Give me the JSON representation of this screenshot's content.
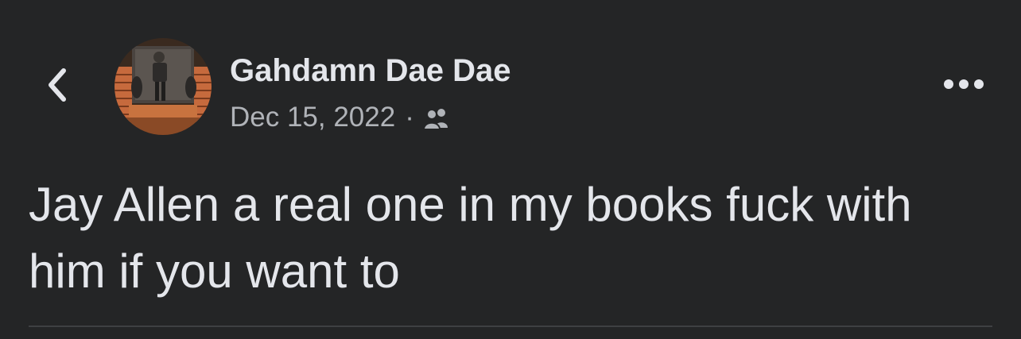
{
  "header": {
    "back_icon": "chevron-left-icon",
    "more_icon": "more-horizontal-icon"
  },
  "post": {
    "author_name": "Gahdamn Dae Dae",
    "date": "Dec 15, 2022",
    "separator": "·",
    "audience_icon": "friends-icon",
    "text": "Jay Allen a real one in my books fuck with him if you want to"
  },
  "colors": {
    "background": "#242526",
    "primary_text": "#e4e6eb",
    "secondary_text": "#b0b3b8",
    "divider": "#3e4042"
  }
}
